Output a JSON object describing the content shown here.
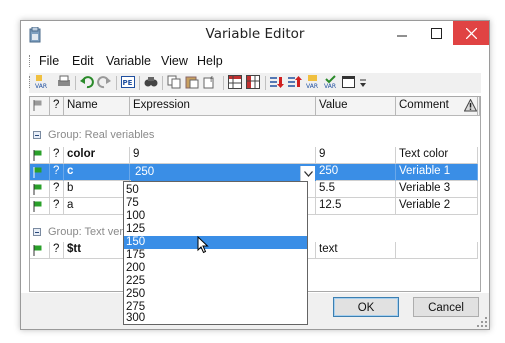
{
  "window": {
    "title": "Variable Editor"
  },
  "icons": {
    "app": "variable-app-icon",
    "minimize": "minimize-icon",
    "maximize": "maximize-icon",
    "close": "close-icon"
  },
  "menu": [
    "File",
    "Edit",
    "Variable",
    "View",
    "Help"
  ],
  "toolbar_icons": [
    "var-new-icon",
    "print-icon",
    "undo-icon",
    "redo-icon",
    "pe-icon",
    "find-icon",
    "copy-icon",
    "paste-icon",
    "paste-special-icon",
    "grid-icon",
    "grid-alt-icon",
    "move-down-icon",
    "move-up-icon",
    "var-sort-icon",
    "var-check-icon",
    "window-icon",
    "dropdown-arrow-icon"
  ],
  "columns": {
    "flag": "",
    "q": "?",
    "name": "Name",
    "expression": "Expression",
    "value": "Value",
    "comment": "Comment",
    "warn": "warning-icon"
  },
  "groups": [
    {
      "label": "Group: Real veriables",
      "rows": [
        {
          "q": "?",
          "name": "color",
          "expression": "9",
          "value": "9",
          "comment": "Text color"
        },
        {
          "q": "?",
          "name": "c",
          "expression": "250",
          "value": "250",
          "comment": "Veriable 1"
        },
        {
          "q": "?",
          "name": "b",
          "expression": "",
          "value": "5.5",
          "comment": "Veriable 3"
        },
        {
          "q": "?",
          "name": "a",
          "expression": "",
          "value": "12.5",
          "comment": "Veriable 2"
        }
      ]
    },
    {
      "label": "Group: Text veria",
      "rows": [
        {
          "q": "?",
          "name": "$tt",
          "expression": "",
          "value": "text",
          "comment": ""
        }
      ]
    }
  ],
  "dropdown": {
    "options": [
      "50",
      "75",
      "100",
      "125",
      "150",
      "175",
      "200",
      "225",
      "250",
      "275",
      "300"
    ],
    "highlighted": 4
  },
  "buttons": {
    "ok": "OK",
    "cancel": "Cancel"
  },
  "colors": {
    "selection": "#3a8ee6",
    "close_button": "#e04343"
  }
}
